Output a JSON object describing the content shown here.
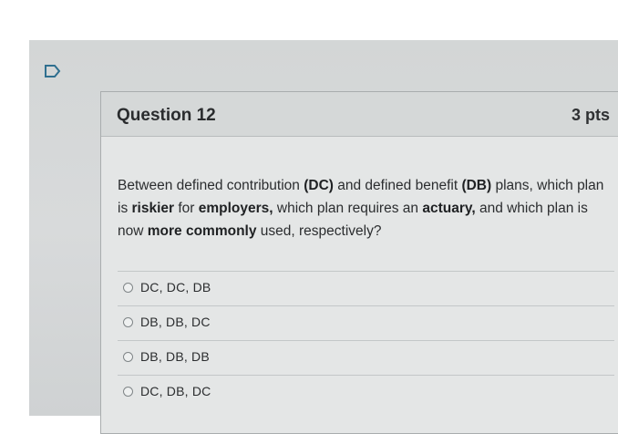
{
  "question": {
    "title": "Question 12",
    "points": "3 pts",
    "text": {
      "p1": "Between defined contribution ",
      "dc": "(DC)",
      "p2": " and defined benefit ",
      "db": "(DB)",
      "p3": " plans, which plan is ",
      "riskier": "riskier",
      "p4": " for ",
      "employers": "employers,",
      "p5": " which plan requires an ",
      "actuary": "actuary,",
      "p6": " and which plan is now ",
      "more_commonly": "more commonly",
      "p7": " used, respectively?"
    }
  },
  "answers": [
    {
      "label": "DC, DC, DB"
    },
    {
      "label": "DB, DB, DC"
    },
    {
      "label": "DB, DB, DB"
    },
    {
      "label": "DC, DB, DC"
    }
  ],
  "icons": {
    "flag": "flag-icon"
  },
  "colors": {
    "card_bg": "#e4e6e6",
    "header_bg": "#d5d8d8",
    "text": "#2b2d2f"
  }
}
